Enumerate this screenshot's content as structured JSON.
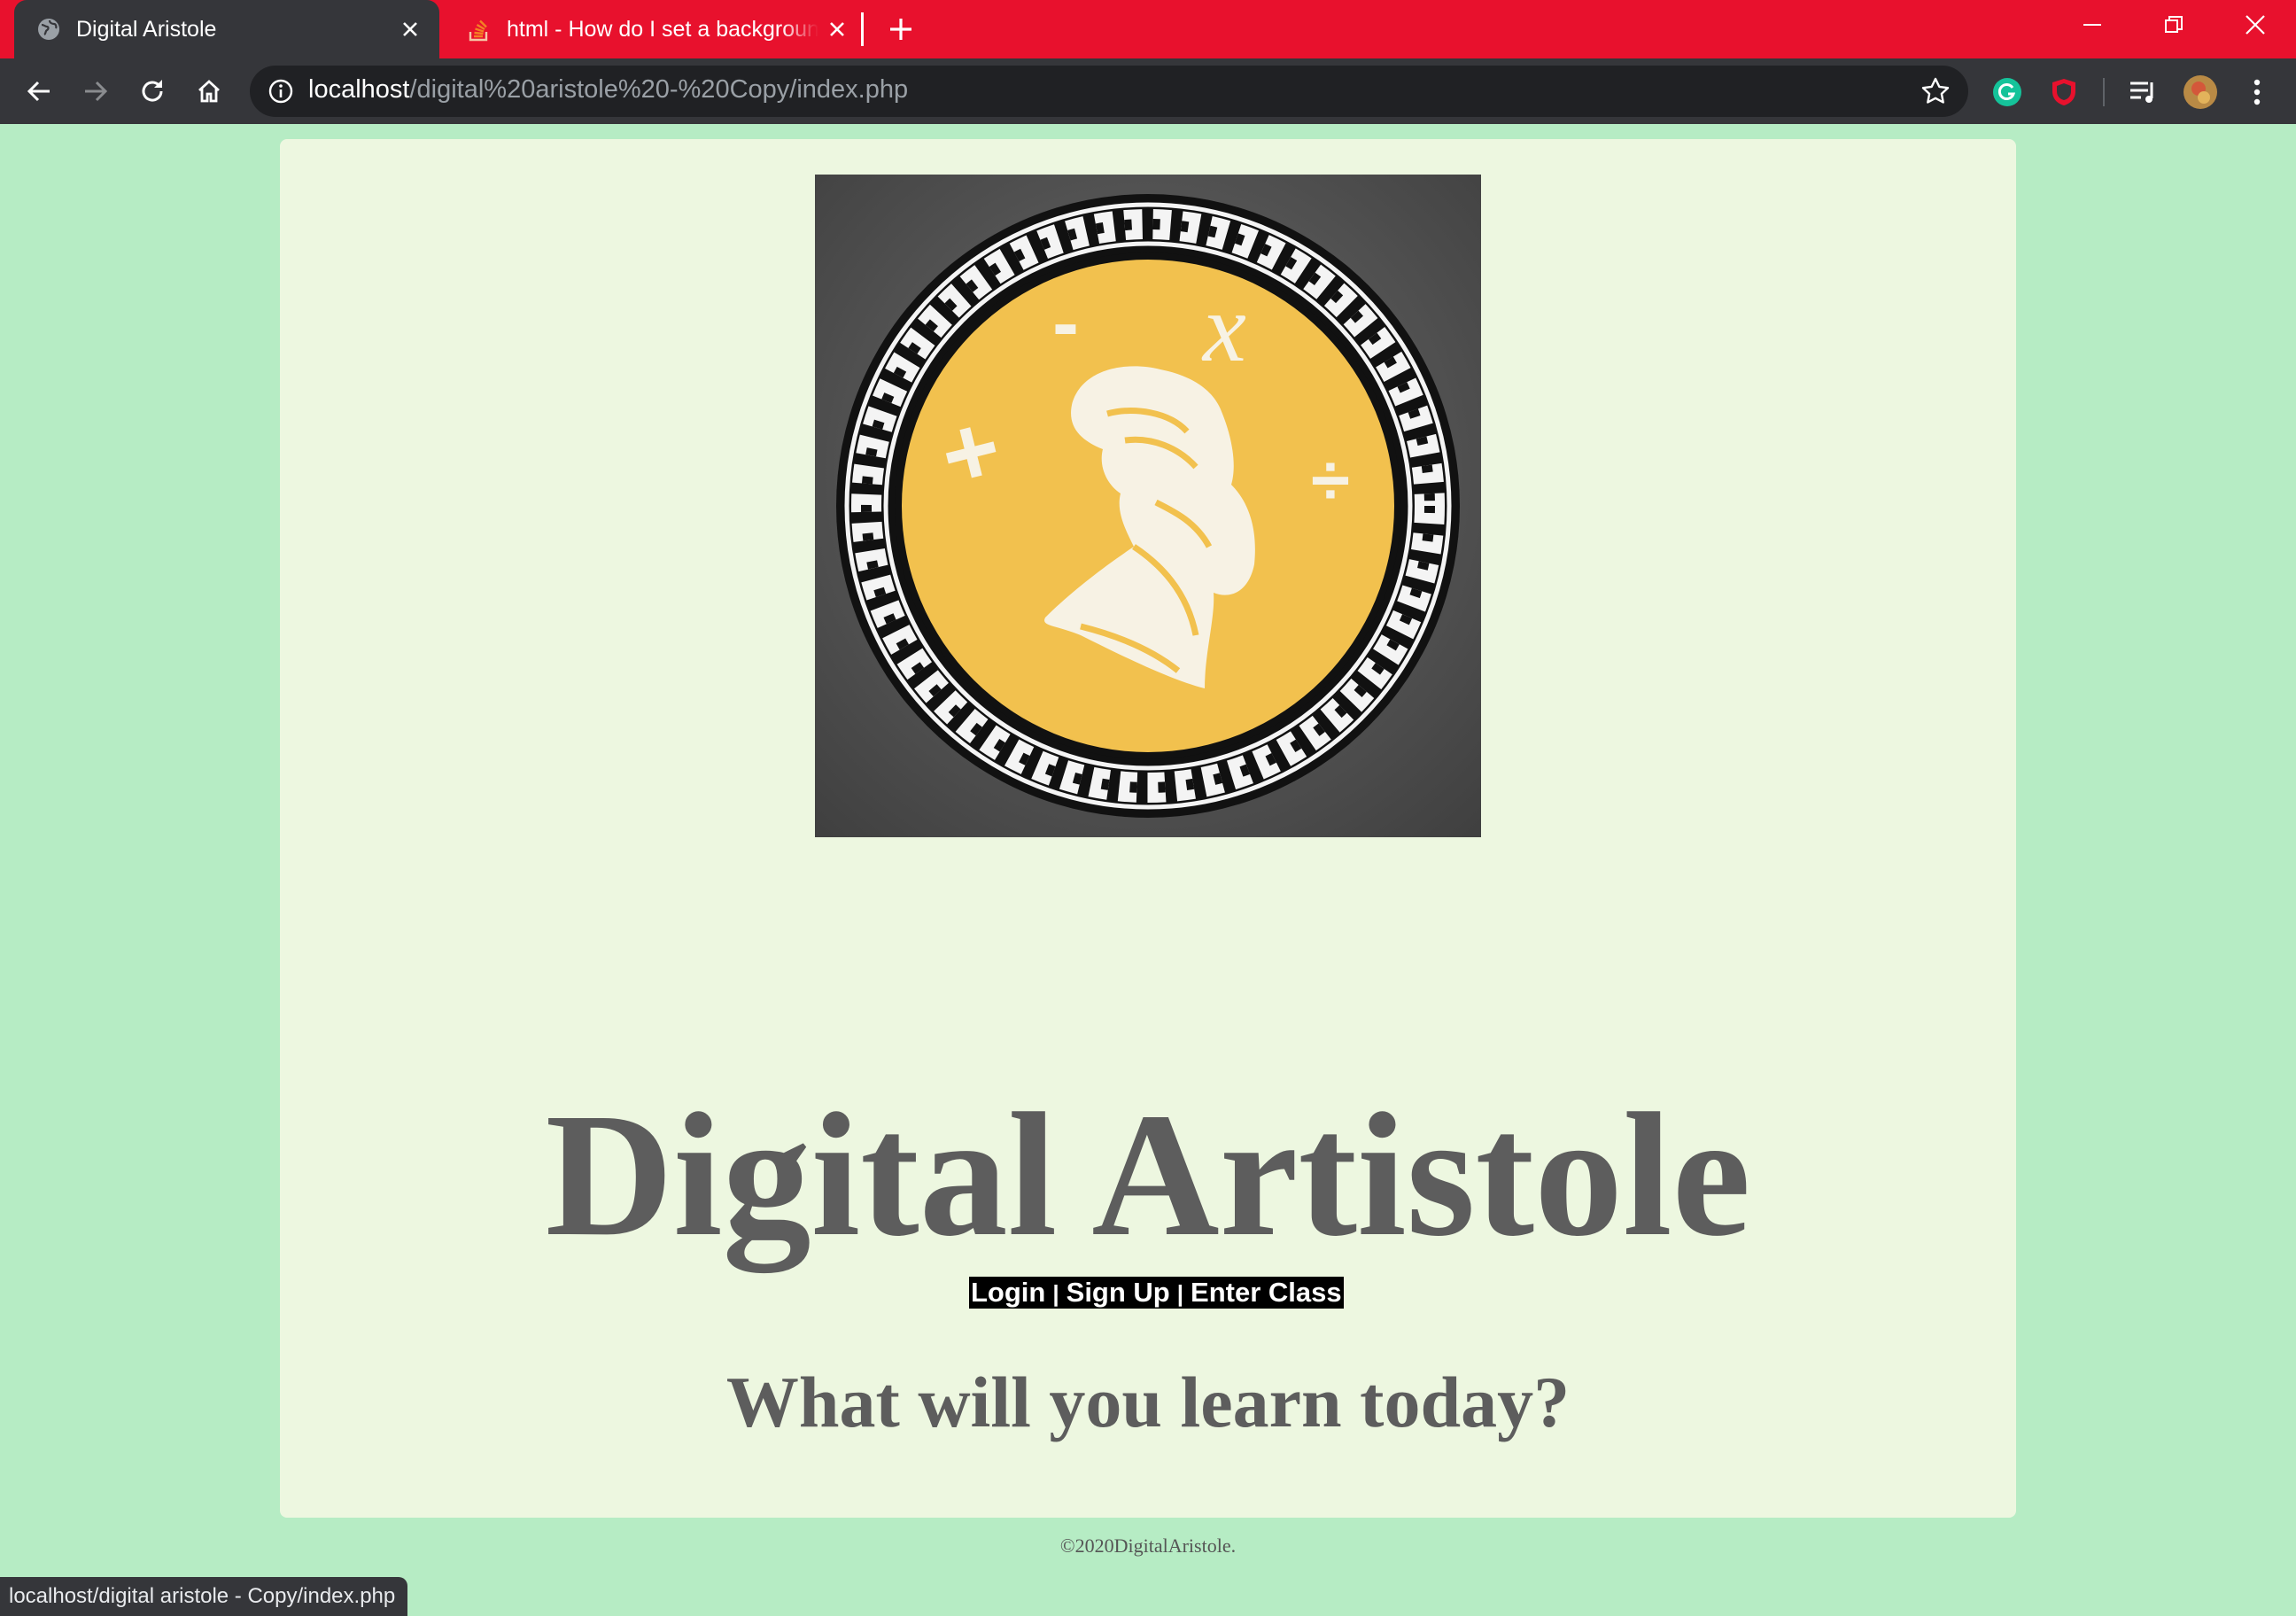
{
  "browser": {
    "tabs": [
      {
        "title": "Digital Aristole",
        "active": true,
        "icon": "globe-icon"
      },
      {
        "title": "html - How do I set a background",
        "active": false,
        "icon": "stackoverflow-icon"
      }
    ],
    "address": {
      "host": "localhost",
      "path": "/digital%20aristole%20-%20Copy/index.php"
    },
    "status_url": "localhost/digital aristole - Copy/index.php",
    "theme_color": "#e8112d",
    "extensions": [
      "grammarly-icon",
      "shield-icon",
      "media-queue-icon",
      "profile-avatar"
    ]
  },
  "page": {
    "background": "#b6ecc4",
    "panel_color": "#edf7e0",
    "title": "Digital Artistole",
    "nav": {
      "login": "Login",
      "separator": "|",
      "signup": "Sign Up",
      "enter_class": "Enter Class"
    },
    "tagline": "What will you learn today?",
    "footer": "©2020DigitalAristole.",
    "logo": {
      "symbols": [
        "-",
        "x",
        "+",
        "÷"
      ],
      "colors": {
        "coin": "#f2c14e",
        "border": "#111111",
        "backdrop": "#4a4a4a"
      }
    }
  }
}
